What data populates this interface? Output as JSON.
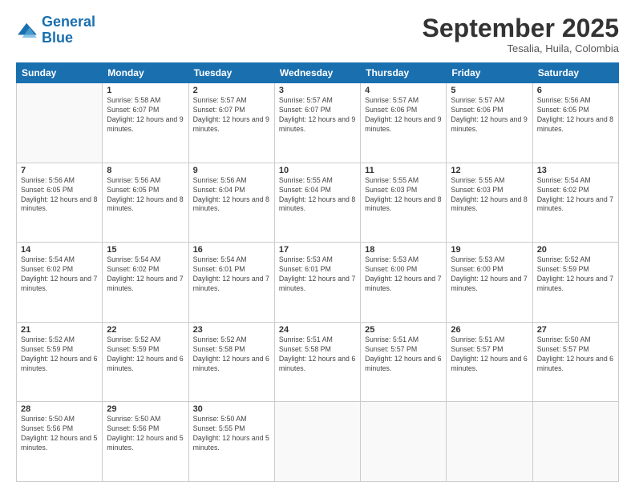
{
  "logo": {
    "line1": "General",
    "line2": "Blue"
  },
  "title": "September 2025",
  "subtitle": "Tesalia, Huila, Colombia",
  "days_header": [
    "Sunday",
    "Monday",
    "Tuesday",
    "Wednesday",
    "Thursday",
    "Friday",
    "Saturday"
  ],
  "weeks": [
    [
      {
        "day": "",
        "info": ""
      },
      {
        "day": "1",
        "info": "Sunrise: 5:58 AM\nSunset: 6:07 PM\nDaylight: 12 hours\nand 9 minutes."
      },
      {
        "day": "2",
        "info": "Sunrise: 5:57 AM\nSunset: 6:07 PM\nDaylight: 12 hours\nand 9 minutes."
      },
      {
        "day": "3",
        "info": "Sunrise: 5:57 AM\nSunset: 6:07 PM\nDaylight: 12 hours\nand 9 minutes."
      },
      {
        "day": "4",
        "info": "Sunrise: 5:57 AM\nSunset: 6:06 PM\nDaylight: 12 hours\nand 9 minutes."
      },
      {
        "day": "5",
        "info": "Sunrise: 5:57 AM\nSunset: 6:06 PM\nDaylight: 12 hours\nand 9 minutes."
      },
      {
        "day": "6",
        "info": "Sunrise: 5:56 AM\nSunset: 6:05 PM\nDaylight: 12 hours\nand 8 minutes."
      }
    ],
    [
      {
        "day": "7",
        "info": "Sunrise: 5:56 AM\nSunset: 6:05 PM\nDaylight: 12 hours\nand 8 minutes."
      },
      {
        "day": "8",
        "info": "Sunrise: 5:56 AM\nSunset: 6:05 PM\nDaylight: 12 hours\nand 8 minutes."
      },
      {
        "day": "9",
        "info": "Sunrise: 5:56 AM\nSunset: 6:04 PM\nDaylight: 12 hours\nand 8 minutes."
      },
      {
        "day": "10",
        "info": "Sunrise: 5:55 AM\nSunset: 6:04 PM\nDaylight: 12 hours\nand 8 minutes."
      },
      {
        "day": "11",
        "info": "Sunrise: 5:55 AM\nSunset: 6:03 PM\nDaylight: 12 hours\nand 8 minutes."
      },
      {
        "day": "12",
        "info": "Sunrise: 5:55 AM\nSunset: 6:03 PM\nDaylight: 12 hours\nand 8 minutes."
      },
      {
        "day": "13",
        "info": "Sunrise: 5:54 AM\nSunset: 6:02 PM\nDaylight: 12 hours\nand 7 minutes."
      }
    ],
    [
      {
        "day": "14",
        "info": "Sunrise: 5:54 AM\nSunset: 6:02 PM\nDaylight: 12 hours\nand 7 minutes."
      },
      {
        "day": "15",
        "info": "Sunrise: 5:54 AM\nSunset: 6:02 PM\nDaylight: 12 hours\nand 7 minutes."
      },
      {
        "day": "16",
        "info": "Sunrise: 5:54 AM\nSunset: 6:01 PM\nDaylight: 12 hours\nand 7 minutes."
      },
      {
        "day": "17",
        "info": "Sunrise: 5:53 AM\nSunset: 6:01 PM\nDaylight: 12 hours\nand 7 minutes."
      },
      {
        "day": "18",
        "info": "Sunrise: 5:53 AM\nSunset: 6:00 PM\nDaylight: 12 hours\nand 7 minutes."
      },
      {
        "day": "19",
        "info": "Sunrise: 5:53 AM\nSunset: 6:00 PM\nDaylight: 12 hours\nand 7 minutes."
      },
      {
        "day": "20",
        "info": "Sunrise: 5:52 AM\nSunset: 5:59 PM\nDaylight: 12 hours\nand 7 minutes."
      }
    ],
    [
      {
        "day": "21",
        "info": "Sunrise: 5:52 AM\nSunset: 5:59 PM\nDaylight: 12 hours\nand 6 minutes."
      },
      {
        "day": "22",
        "info": "Sunrise: 5:52 AM\nSunset: 5:59 PM\nDaylight: 12 hours\nand 6 minutes."
      },
      {
        "day": "23",
        "info": "Sunrise: 5:52 AM\nSunset: 5:58 PM\nDaylight: 12 hours\nand 6 minutes."
      },
      {
        "day": "24",
        "info": "Sunrise: 5:51 AM\nSunset: 5:58 PM\nDaylight: 12 hours\nand 6 minutes."
      },
      {
        "day": "25",
        "info": "Sunrise: 5:51 AM\nSunset: 5:57 PM\nDaylight: 12 hours\nand 6 minutes."
      },
      {
        "day": "26",
        "info": "Sunrise: 5:51 AM\nSunset: 5:57 PM\nDaylight: 12 hours\nand 6 minutes."
      },
      {
        "day": "27",
        "info": "Sunrise: 5:50 AM\nSunset: 5:57 PM\nDaylight: 12 hours\nand 6 minutes."
      }
    ],
    [
      {
        "day": "28",
        "info": "Sunrise: 5:50 AM\nSunset: 5:56 PM\nDaylight: 12 hours\nand 5 minutes."
      },
      {
        "day": "29",
        "info": "Sunrise: 5:50 AM\nSunset: 5:56 PM\nDaylight: 12 hours\nand 5 minutes."
      },
      {
        "day": "30",
        "info": "Sunrise: 5:50 AM\nSunset: 5:55 PM\nDaylight: 12 hours\nand 5 minutes."
      },
      {
        "day": "",
        "info": ""
      },
      {
        "day": "",
        "info": ""
      },
      {
        "day": "",
        "info": ""
      },
      {
        "day": "",
        "info": ""
      }
    ]
  ]
}
